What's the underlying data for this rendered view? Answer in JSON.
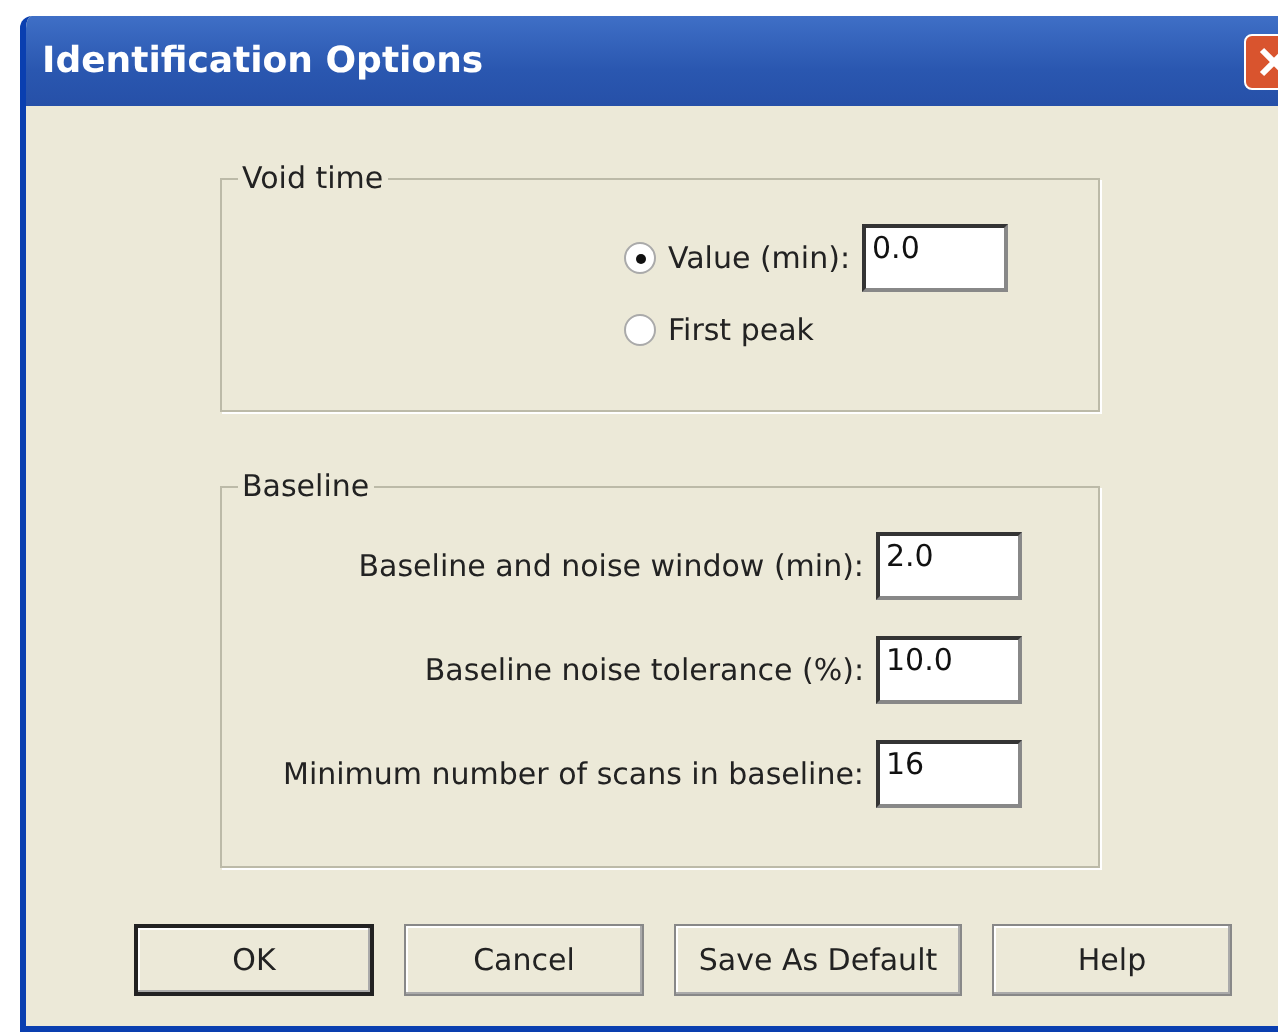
{
  "window": {
    "title": "Identification Options"
  },
  "void_time": {
    "title": "Void time",
    "options": [
      {
        "label": "Value (min):",
        "selected": true,
        "value": "0.0"
      },
      {
        "label": "First peak",
        "selected": false
      }
    ]
  },
  "baseline": {
    "title": "Baseline",
    "fields": [
      {
        "label": "Baseline and noise window (min):",
        "value": "2.0"
      },
      {
        "label": "Baseline noise tolerance (%):",
        "value": "10.0"
      },
      {
        "label": "Minimum number of scans in baseline:",
        "value": "16"
      }
    ]
  },
  "buttons": [
    {
      "label": "OK",
      "default": true
    },
    {
      "label": "Cancel",
      "default": false
    },
    {
      "label": "Save As Default",
      "default": false
    },
    {
      "label": "Help",
      "default": false
    }
  ]
}
